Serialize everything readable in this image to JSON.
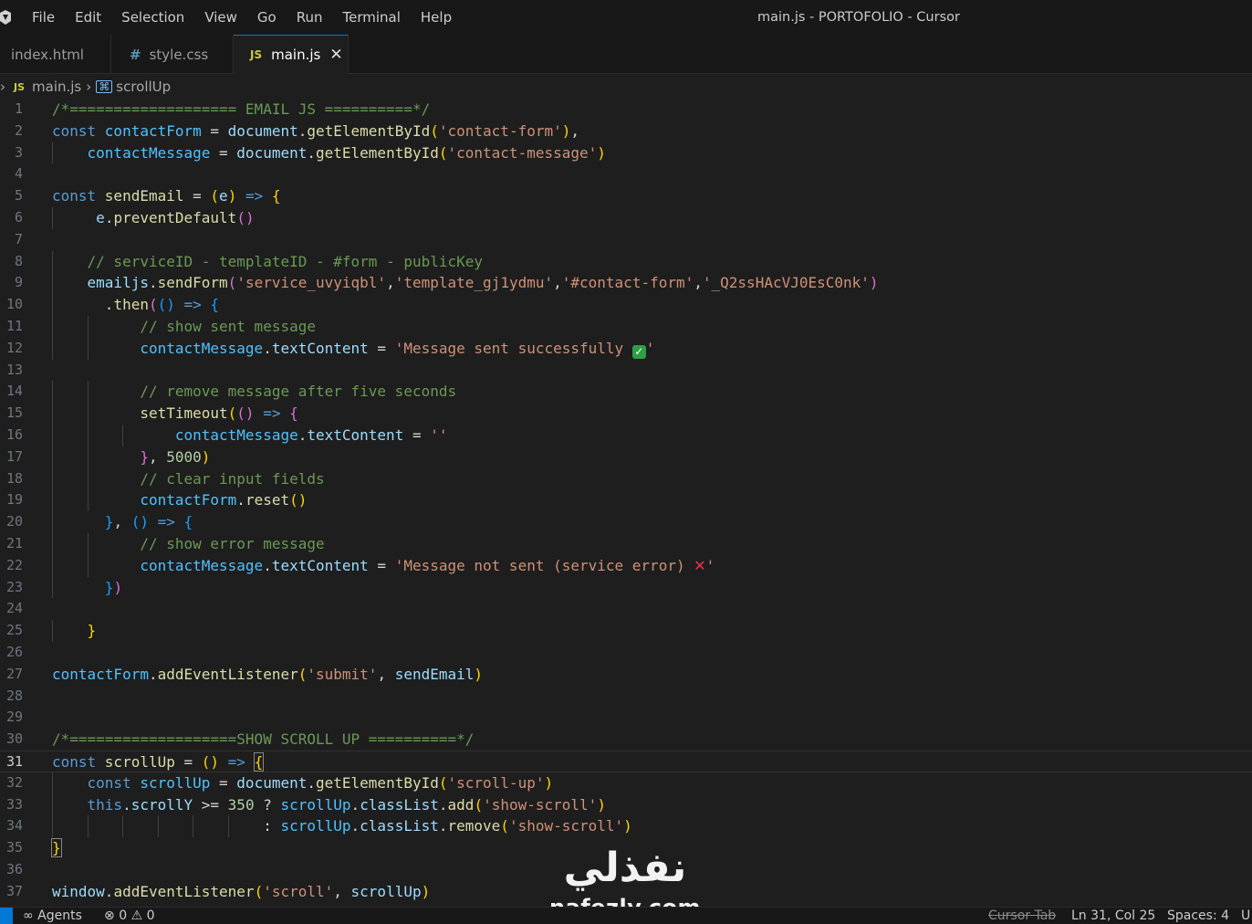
{
  "window": {
    "title": "main.js - PORTOFOLIO - Cursor",
    "menu": [
      "File",
      "Edit",
      "Selection",
      "View",
      "Go",
      "Run",
      "Terminal",
      "Help"
    ]
  },
  "tabs": [
    {
      "label": "index.html",
      "icon": "html-file-icon",
      "active": false
    },
    {
      "label": "style.css",
      "icon": "#",
      "active": false
    },
    {
      "label": "main.js",
      "icon": "JS",
      "active": true
    }
  ],
  "breadcrumb": {
    "js_icon": "JS",
    "file": "main.js",
    "symbol": "scrollUp"
  },
  "editor": {
    "active_line": 31,
    "colors": {
      "comment": "#6a9955",
      "keyword": "#569cd6",
      "constant": "#4fc1ff",
      "variable": "#9cdcfe",
      "function": "#dcdcaa",
      "string": "#ce9178",
      "number": "#b5cea8"
    },
    "lines": [
      [
        [
          "cm",
          "/*=================== EMAIL JS ==========*/"
        ]
      ],
      [
        [
          "kw",
          "const "
        ],
        [
          "var",
          "contactForm"
        ],
        [
          "op",
          " = "
        ],
        [
          "vl",
          "document"
        ],
        [
          "op",
          "."
        ],
        [
          "fn",
          "getElementById"
        ],
        [
          "b1",
          "("
        ],
        [
          "str",
          "'contact-form'"
        ],
        [
          "b1",
          ")"
        ],
        [
          "op",
          ","
        ]
      ],
      [
        [
          "op",
          "    "
        ],
        [
          "var",
          "contactMessage"
        ],
        [
          "op",
          " = "
        ],
        [
          "vl",
          "document"
        ],
        [
          "op",
          "."
        ],
        [
          "fn",
          "getElementById"
        ],
        [
          "b1",
          "("
        ],
        [
          "str",
          "'contact-message'"
        ],
        [
          "b1",
          ")"
        ]
      ],
      [],
      [
        [
          "kw",
          "const "
        ],
        [
          "fn",
          "sendEmail"
        ],
        [
          "op",
          " = "
        ],
        [
          "b1",
          "("
        ],
        [
          "vl",
          "e"
        ],
        [
          "b1",
          ")"
        ],
        [
          "kw",
          " => "
        ],
        [
          "b1",
          "{"
        ]
      ],
      [
        [
          "op",
          "     "
        ],
        [
          "vl",
          "e"
        ],
        [
          "op",
          "."
        ],
        [
          "fn",
          "preventDefault"
        ],
        [
          "b2",
          "()"
        ]
      ],
      [],
      [
        [
          "op",
          "    "
        ],
        [
          "cm",
          "// serviceID - templateID - #form - publicKey"
        ]
      ],
      [
        [
          "op",
          "    "
        ],
        [
          "vl",
          "emailjs"
        ],
        [
          "op",
          "."
        ],
        [
          "fn",
          "sendForm"
        ],
        [
          "b2",
          "("
        ],
        [
          "str",
          "'service_uvyiqbl'"
        ],
        [
          "op",
          ","
        ],
        [
          "str",
          "'template_gj1ydmu'"
        ],
        [
          "op",
          ","
        ],
        [
          "str",
          "'#contact-form'"
        ],
        [
          "op",
          ","
        ],
        [
          "str",
          "'_Q2ssHAcVJ0EsC0nk'"
        ],
        [
          "b2",
          ")"
        ]
      ],
      [
        [
          "op",
          "      ."
        ],
        [
          "fn",
          "then"
        ],
        [
          "b2",
          "("
        ],
        [
          "b3",
          "()"
        ],
        [
          "kw",
          " => "
        ],
        [
          "b3",
          "{"
        ]
      ],
      [
        [
          "op",
          "          "
        ],
        [
          "cm",
          "// show sent message"
        ]
      ],
      [
        [
          "op",
          "          "
        ],
        [
          "var",
          "contactMessage"
        ],
        [
          "op",
          "."
        ],
        [
          "vl",
          "textContent"
        ],
        [
          "op",
          " = "
        ],
        [
          "str",
          "'Message sent successfully "
        ],
        [
          "chk",
          "✓"
        ],
        [
          "str",
          "'"
        ]
      ],
      [],
      [
        [
          "op",
          "          "
        ],
        [
          "cm",
          "// remove message after five seconds"
        ]
      ],
      [
        [
          "op",
          "          "
        ],
        [
          "fn",
          "setTimeout"
        ],
        [
          "b1",
          "("
        ],
        [
          "b2",
          "()"
        ],
        [
          "kw",
          " => "
        ],
        [
          "b2",
          "{"
        ]
      ],
      [
        [
          "op",
          "              "
        ],
        [
          "var",
          "contactMessage"
        ],
        [
          "op",
          "."
        ],
        [
          "vl",
          "textContent"
        ],
        [
          "op",
          " = "
        ],
        [
          "str",
          "''"
        ]
      ],
      [
        [
          "op",
          "          "
        ],
        [
          "b2",
          "}"
        ],
        [
          "op",
          ", "
        ],
        [
          "num",
          "5000"
        ],
        [
          "b1",
          ")"
        ]
      ],
      [
        [
          "op",
          "          "
        ],
        [
          "cm",
          "// clear input fields"
        ]
      ],
      [
        [
          "op",
          "          "
        ],
        [
          "var",
          "contactForm"
        ],
        [
          "op",
          "."
        ],
        [
          "fn",
          "reset"
        ],
        [
          "b1",
          "()"
        ]
      ],
      [
        [
          "op",
          "      "
        ],
        [
          "b3",
          "}"
        ],
        [
          "op",
          ", "
        ],
        [
          "b3",
          "()"
        ],
        [
          "kw",
          " => "
        ],
        [
          "b3",
          "{"
        ]
      ],
      [
        [
          "op",
          "          "
        ],
        [
          "cm",
          "// show error message"
        ]
      ],
      [
        [
          "op",
          "          "
        ],
        [
          "var",
          "contactMessage"
        ],
        [
          "op",
          "."
        ],
        [
          "vl",
          "textContent"
        ],
        [
          "op",
          " = "
        ],
        [
          "str",
          "'Message not sent (service error) "
        ],
        [
          "crs",
          "✕"
        ],
        [
          "str",
          "'"
        ]
      ],
      [
        [
          "op",
          "      "
        ],
        [
          "b3",
          "}"
        ],
        [
          "b2",
          ")"
        ]
      ],
      [],
      [
        [
          "op",
          "    "
        ],
        [
          "b1",
          "}"
        ]
      ],
      [],
      [
        [
          "var",
          "contactForm"
        ],
        [
          "op",
          "."
        ],
        [
          "fn",
          "addEventListener"
        ],
        [
          "b1",
          "("
        ],
        [
          "str",
          "'submit'"
        ],
        [
          "op",
          ", "
        ],
        [
          "vl",
          "sendEmail"
        ],
        [
          "b1",
          ")"
        ]
      ],
      [],
      [],
      [
        [
          "cm",
          "/*===================SHOW SCROLL UP ==========*/"
        ]
      ],
      [
        [
          "kw",
          "const "
        ],
        [
          "fn",
          "scrollUp"
        ],
        [
          "op",
          " = "
        ],
        [
          "b1",
          "()"
        ],
        [
          "kw",
          " => "
        ],
        [
          "cur",
          "{"
        ]
      ],
      [
        [
          "op",
          "    "
        ],
        [
          "kw",
          "const "
        ],
        [
          "var",
          "scrollUp"
        ],
        [
          "op",
          " = "
        ],
        [
          "vl",
          "document"
        ],
        [
          "op",
          "."
        ],
        [
          "fn",
          "getElementById"
        ],
        [
          "b1",
          "("
        ],
        [
          "str",
          "'scroll-up'"
        ],
        [
          "b1",
          ")"
        ]
      ],
      [
        [
          "op",
          "    "
        ],
        [
          "kw",
          "this"
        ],
        [
          "op",
          "."
        ],
        [
          "vl",
          "scrollY"
        ],
        [
          "op",
          " >= "
        ],
        [
          "num",
          "350"
        ],
        [
          "op",
          " ? "
        ],
        [
          "var",
          "scrollUp"
        ],
        [
          "op",
          "."
        ],
        [
          "vl",
          "classList"
        ],
        [
          "op",
          "."
        ],
        [
          "fn",
          "add"
        ],
        [
          "b1",
          "("
        ],
        [
          "str",
          "'show-scroll'"
        ],
        [
          "b1",
          ")"
        ]
      ],
      [
        [
          "op",
          "                        : "
        ],
        [
          "var",
          "scrollUp"
        ],
        [
          "op",
          "."
        ],
        [
          "vl",
          "classList"
        ],
        [
          "op",
          "."
        ],
        [
          "fn",
          "remove"
        ],
        [
          "b1",
          "("
        ],
        [
          "str",
          "'show-scroll'"
        ],
        [
          "b1",
          ")"
        ]
      ],
      [
        [
          "cur",
          "}"
        ]
      ],
      [],
      [
        [
          "vl",
          "window"
        ],
        [
          "op",
          "."
        ],
        [
          "fn",
          "addEventListener"
        ],
        [
          "b1",
          "("
        ],
        [
          "str",
          "'scroll'"
        ],
        [
          "op",
          ", "
        ],
        [
          "vl",
          "scrollUp"
        ],
        [
          "b1",
          ")"
        ]
      ]
    ]
  },
  "watermark": {
    "arabic": "نفذلي",
    "latin": "nafezly.com"
  },
  "statusbar": {
    "agents": "Agents",
    "errors": "0",
    "warnings": "0",
    "cursor_tab": "Cursor Tab",
    "position": "Ln 31, Col 25",
    "spaces": "Spaces: 4",
    "trailing": "U"
  }
}
